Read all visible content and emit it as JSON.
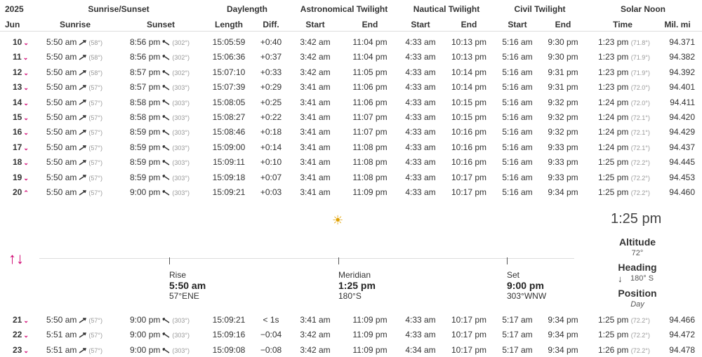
{
  "header": {
    "year": "2025",
    "month": "Jun",
    "groups": {
      "sunrise_sunset": "Sunrise/Sunset",
      "daylength": "Daylength",
      "astronomical": "Astronomical Twilight",
      "nautical": "Nautical Twilight",
      "civil": "Civil Twilight",
      "solar_noon": "Solar Noon"
    },
    "columns": {
      "sunrise": "Sunrise",
      "sunset": "Sunset",
      "length": "Length",
      "diff": "Diff.",
      "astro_start": "Start",
      "astro_end": "End",
      "naut_start": "Start",
      "naut_end": "End",
      "civil_start": "Start",
      "civil_end": "End",
      "noon_time": "Time",
      "mil_mi": "Mil. mi"
    }
  },
  "rows_top": [
    {
      "day": "10",
      "chev": "⌄",
      "sunrise": "5:50 am",
      "sr_deg": "(58°)",
      "sunset": "8:56 pm",
      "ss_deg": "(302°)",
      "length": "15:05:59",
      "diff": "+0:40",
      "a_start": "3:42 am",
      "a_end": "11:04 pm",
      "n_start": "4:33 am",
      "n_end": "10:13 pm",
      "c_start": "5:16 am",
      "c_end": "9:30 pm",
      "noon": "1:23 pm",
      "noon_deg": "(71.8°)",
      "mil": "94.371"
    },
    {
      "day": "11",
      "chev": "⌄",
      "sunrise": "5:50 am",
      "sr_deg": "(58°)",
      "sunset": "8:56 pm",
      "ss_deg": "(302°)",
      "length": "15:06:36",
      "diff": "+0:37",
      "a_start": "3:42 am",
      "a_end": "11:04 pm",
      "n_start": "4:33 am",
      "n_end": "10:13 pm",
      "c_start": "5:16 am",
      "c_end": "9:30 pm",
      "noon": "1:23 pm",
      "noon_deg": "(71.9°)",
      "mil": "94.382"
    },
    {
      "day": "12",
      "chev": "⌄",
      "sunrise": "5:50 am",
      "sr_deg": "(58°)",
      "sunset": "8:57 pm",
      "ss_deg": "(302°)",
      "length": "15:07:10",
      "diff": "+0:33",
      "a_start": "3:42 am",
      "a_end": "11:05 pm",
      "n_start": "4:33 am",
      "n_end": "10:14 pm",
      "c_start": "5:16 am",
      "c_end": "9:31 pm",
      "noon": "1:23 pm",
      "noon_deg": "(71.9°)",
      "mil": "94.392"
    },
    {
      "day": "13",
      "chev": "⌄",
      "sunrise": "5:50 am",
      "sr_deg": "(57°)",
      "sunset": "8:57 pm",
      "ss_deg": "(303°)",
      "length": "15:07:39",
      "diff": "+0:29",
      "a_start": "3:41 am",
      "a_end": "11:06 pm",
      "n_start": "4:33 am",
      "n_end": "10:14 pm",
      "c_start": "5:16 am",
      "c_end": "9:31 pm",
      "noon": "1:23 pm",
      "noon_deg": "(72.0°)",
      "mil": "94.401"
    },
    {
      "day": "14",
      "chev": "⌄",
      "sunrise": "5:50 am",
      "sr_deg": "(57°)",
      "sunset": "8:58 pm",
      "ss_deg": "(303°)",
      "length": "15:08:05",
      "diff": "+0:25",
      "a_start": "3:41 am",
      "a_end": "11:06 pm",
      "n_start": "4:33 am",
      "n_end": "10:15 pm",
      "c_start": "5:16 am",
      "c_end": "9:32 pm",
      "noon": "1:24 pm",
      "noon_deg": "(72.0°)",
      "mil": "94.411"
    },
    {
      "day": "15",
      "chev": "⌄",
      "sunrise": "5:50 am",
      "sr_deg": "(57°)",
      "sunset": "8:58 pm",
      "ss_deg": "(303°)",
      "length": "15:08:27",
      "diff": "+0:22",
      "a_start": "3:41 am",
      "a_end": "11:07 pm",
      "n_start": "4:33 am",
      "n_end": "10:15 pm",
      "c_start": "5:16 am",
      "c_end": "9:32 pm",
      "noon": "1:24 pm",
      "noon_deg": "(72.1°)",
      "mil": "94.420"
    },
    {
      "day": "16",
      "chev": "⌄",
      "sunrise": "5:50 am",
      "sr_deg": "(57°)",
      "sunset": "8:59 pm",
      "ss_deg": "(303°)",
      "length": "15:08:46",
      "diff": "+0:18",
      "a_start": "3:41 am",
      "a_end": "11:07 pm",
      "n_start": "4:33 am",
      "n_end": "10:16 pm",
      "c_start": "5:16 am",
      "c_end": "9:32 pm",
      "noon": "1:24 pm",
      "noon_deg": "(72.1°)",
      "mil": "94.429"
    },
    {
      "day": "17",
      "chev": "⌄",
      "sunrise": "5:50 am",
      "sr_deg": "(57°)",
      "sunset": "8:59 pm",
      "ss_deg": "(303°)",
      "length": "15:09:00",
      "diff": "+0:14",
      "a_start": "3:41 am",
      "a_end": "11:08 pm",
      "n_start": "4:33 am",
      "n_end": "10:16 pm",
      "c_start": "5:16 am",
      "c_end": "9:33 pm",
      "noon": "1:24 pm",
      "noon_deg": "(72.1°)",
      "mil": "94.437"
    },
    {
      "day": "18",
      "chev": "⌄",
      "sunrise": "5:50 am",
      "sr_deg": "(57°)",
      "sunset": "8:59 pm",
      "ss_deg": "(303°)",
      "length": "15:09:11",
      "diff": "+0:10",
      "a_start": "3:41 am",
      "a_end": "11:08 pm",
      "n_start": "4:33 am",
      "n_end": "10:16 pm",
      "c_start": "5:16 am",
      "c_end": "9:33 pm",
      "noon": "1:25 pm",
      "noon_deg": "(72.2°)",
      "mil": "94.445"
    },
    {
      "day": "19",
      "chev": "⌄",
      "sunrise": "5:50 am",
      "sr_deg": "(57°)",
      "sunset": "8:59 pm",
      "ss_deg": "(303°)",
      "length": "15:09:18",
      "diff": "+0:07",
      "a_start": "3:41 am",
      "a_end": "11:08 pm",
      "n_start": "4:33 am",
      "n_end": "10:17 pm",
      "c_start": "5:16 am",
      "c_end": "9:33 pm",
      "noon": "1:25 pm",
      "noon_deg": "(72.2°)",
      "mil": "94.453"
    },
    {
      "day": "20",
      "chev": "⌃",
      "sunrise": "5:50 am",
      "sr_deg": "(57°)",
      "sunset": "9:00 pm",
      "ss_deg": "(303°)",
      "length": "15:09:21",
      "diff": "+0:03",
      "a_start": "3:41 am",
      "a_end": "11:09 pm",
      "n_start": "4:33 am",
      "n_end": "10:17 pm",
      "c_start": "5:16 am",
      "c_end": "9:34 pm",
      "noon": "1:25 pm",
      "noon_deg": "(72.2°)",
      "mil": "94.460"
    }
  ],
  "detail": {
    "swap_icon": "↑↓",
    "sun_icon": "☀",
    "rise_label": "Rise",
    "rise_time": "5:50 am",
    "rise_dir": "57°ENE",
    "meridian_label": "Meridian",
    "meridian_time": "1:25 pm",
    "meridian_dir": "180°S",
    "set_label": "Set",
    "set_time": "9:00 pm",
    "set_dir": "303°WNW",
    "current_time": "1:25 pm",
    "altitude_label": "Altitude",
    "altitude_value": "72°",
    "heading_label": "Heading",
    "heading_arrow": "↓",
    "heading_value": "180° S",
    "position_label": "Position",
    "position_value": "Day"
  },
  "rows_bottom": [
    {
      "day": "21",
      "chev": "⌄",
      "sunrise": "5:50 am",
      "sr_deg": "(57°)",
      "sunset": "9:00 pm",
      "ss_deg": "(303°)",
      "length": "15:09:21",
      "diff": "< 1s",
      "a_start": "3:41 am",
      "a_end": "11:09 pm",
      "n_start": "4:33 am",
      "n_end": "10:17 pm",
      "c_start": "5:17 am",
      "c_end": "9:34 pm",
      "noon": "1:25 pm",
      "noon_deg": "(72.2°)",
      "mil": "94.466"
    },
    {
      "day": "22",
      "chev": "⌄",
      "sunrise": "5:51 am",
      "sr_deg": "(57°)",
      "sunset": "9:00 pm",
      "ss_deg": "(303°)",
      "length": "15:09:16",
      "diff": "−0:04",
      "a_start": "3:42 am",
      "a_end": "11:09 pm",
      "n_start": "4:33 am",
      "n_end": "10:17 pm",
      "c_start": "5:17 am",
      "c_end": "9:34 pm",
      "noon": "1:25 pm",
      "noon_deg": "(72.2°)",
      "mil": "94.472"
    },
    {
      "day": "23",
      "chev": "⌄",
      "sunrise": "5:51 am",
      "sr_deg": "(57°)",
      "sunset": "9:00 pm",
      "ss_deg": "(303°)",
      "length": "15:09:08",
      "diff": "−0:08",
      "a_start": "3:42 am",
      "a_end": "11:09 pm",
      "n_start": "4:34 am",
      "n_end": "10:17 pm",
      "c_start": "5:17 am",
      "c_end": "9:34 pm",
      "noon": "1:26 pm",
      "noon_deg": "(72.2°)",
      "mil": "94.478"
    }
  ],
  "colors": {
    "accent": "#d0006f",
    "muted": "#999999",
    "divider": "#dddddd"
  }
}
